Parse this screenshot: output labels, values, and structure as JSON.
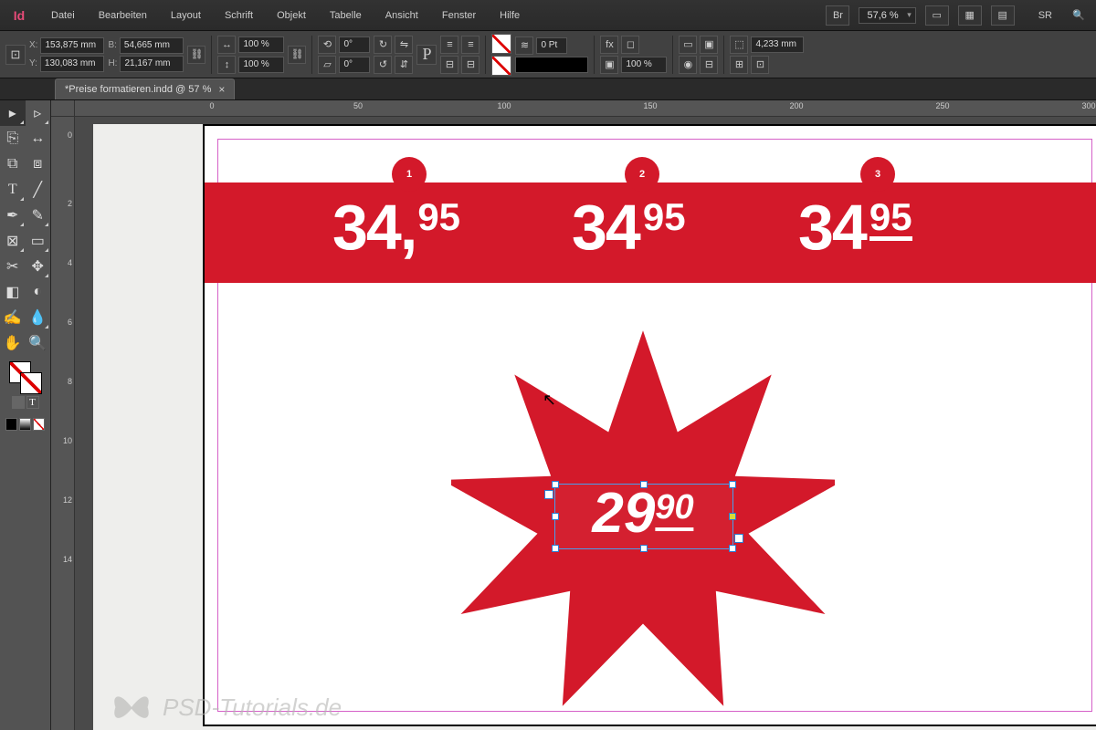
{
  "app_logo": "Id",
  "menu": {
    "items": [
      "Datei",
      "Bearbeiten",
      "Layout",
      "Schrift",
      "Objekt",
      "Tabelle",
      "Ansicht",
      "Fenster",
      "Hilfe"
    ]
  },
  "topbar": {
    "bridge_label": "Br",
    "zoom": "57,6 %",
    "workspace_label": "SR"
  },
  "control": {
    "x": "153,875 mm",
    "y": "130,083 mm",
    "w": "54,665 mm",
    "h": "21,167 mm",
    "scale_x": "100 %",
    "scale_y": "100 %",
    "rotate": "0°",
    "shear": "0°",
    "stroke": "0 Pt",
    "opacity": "100 %",
    "corner": "4,233 mm"
  },
  "doc_tab": {
    "title": "*Preise formatieren.indd @ 57 %"
  },
  "ruler": {
    "h": [
      "0",
      "50",
      "100",
      "150",
      "200",
      "250",
      "300"
    ],
    "v": [
      "0",
      "2",
      "4",
      "6",
      "8",
      "10",
      "12",
      "14"
    ]
  },
  "banner": {
    "badges": [
      "1",
      "2",
      "3"
    ],
    "prices": [
      {
        "int": "34",
        "sep": ",",
        "dec": "95"
      },
      {
        "int": "34",
        "sep": "",
        "dec": "95"
      },
      {
        "int": "34",
        "sep": "",
        "dec": "95"
      }
    ]
  },
  "star_price": {
    "int": "29",
    "dec": "90"
  },
  "watermark": "PSD-Tutorials.de"
}
